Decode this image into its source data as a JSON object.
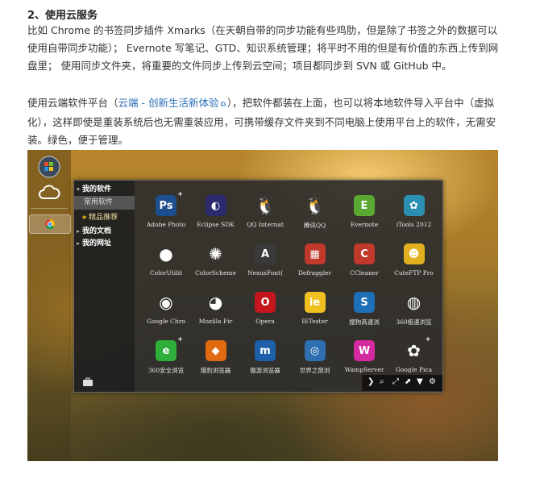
{
  "heading": "2、使用云服务",
  "para1": "比如 Chrome 的书签同步插件 Xmarks（在天朝自带的同步功能有些鸡肋，但是除了书签之外的数据可以使用自带同步功能）；  Evernote 写笔记、GTD、知识系统管理；将平时不用的但是有价值的东西上传到网盘里；  使用同步文件夹，将重要的文件同步上传到云空间；项目都同步到 SVN 或 GitHub 中。",
  "para2_before": "使用云端软件平台（",
  "para2_link": "云端 - 创新生活新体验",
  "para2_after": "），把软件都装在上面，也可以将本地软件导入平台中（虚拟化），这样即使是重装系统后也无需重装应用，可携带缓存文件夹到不同电脑上使用平台上的软件，无需安装。绿色，便于管理。",
  "nav": {
    "my_software": "我的软件",
    "common": "常用软件",
    "featured": "精品推荐",
    "my_docs": "我的文档",
    "my_sites": "我的网址"
  },
  "apps": [
    {
      "label": "Adobe Photo",
      "icon": "photoshop-icon",
      "glyph": "Ps",
      "color": "#1c4f8f",
      "plus": true
    },
    {
      "label": "Eclipse SDK",
      "icon": "eclipse-icon",
      "glyph": "◐",
      "color": "#2c2a6e",
      "plus": false
    },
    {
      "label": "QQ Internat",
      "icon": "qq-icon",
      "glyph": "🐧",
      "color": "transparent",
      "plus": false
    },
    {
      "label": "腾讯QQ",
      "icon": "qq-icon",
      "glyph": "🐧",
      "color": "transparent",
      "plus": false
    },
    {
      "label": "Evernote",
      "icon": "evernote-icon",
      "glyph": "E",
      "color": "#5aa832",
      "plus": false
    },
    {
      "label": "iTools 2012",
      "icon": "itools-icon",
      "glyph": "✿",
      "color": "#2a8fb0",
      "plus": false
    },
    {
      "label": "ColorUtilit",
      "icon": "color-wheel-icon",
      "glyph": "●",
      "color": "transparent",
      "plus": false
    },
    {
      "label": "ColorScheme",
      "icon": "color-scheme-icon",
      "glyph": "✺",
      "color": "transparent",
      "plus": false
    },
    {
      "label": "NexusFont(",
      "icon": "nexusfont-icon",
      "glyph": "A",
      "color": "#3a3a3a",
      "plus": false
    },
    {
      "label": "Defraggler",
      "icon": "defraggler-icon",
      "glyph": "▦",
      "color": "#c0392b",
      "plus": false
    },
    {
      "label": "CCleaner",
      "icon": "ccleaner-icon",
      "glyph": "C",
      "color": "#c0392b",
      "plus": false
    },
    {
      "label": "CuteFTP Pro",
      "icon": "cuteftp-icon",
      "glyph": "☻",
      "color": "#e0b020",
      "plus": false
    },
    {
      "label": "Google Chro",
      "icon": "chrome-icon",
      "glyph": "◉",
      "color": "transparent",
      "plus": false
    },
    {
      "label": "Mozilla Fir",
      "icon": "firefox-icon",
      "glyph": "◕",
      "color": "transparent",
      "plus": false
    },
    {
      "label": "Opera",
      "icon": "opera-icon",
      "glyph": "O",
      "color": "#c4161c",
      "plus": false
    },
    {
      "label": "IETester",
      "icon": "ietester-icon",
      "glyph": "ie",
      "color": "#f0c020",
      "plus": false
    },
    {
      "label": "搜狗高速浏",
      "icon": "sogou-icon",
      "glyph": "S",
      "color": "#1d6fb8",
      "plus": false
    },
    {
      "label": "360极速浏览",
      "icon": "360-extreme-icon",
      "glyph": "◍",
      "color": "transparent",
      "plus": false
    },
    {
      "label": "360安全浏览",
      "icon": "360-safe-icon",
      "glyph": "e",
      "color": "#2eae3a",
      "plus": true
    },
    {
      "label": "猎豹浏览器",
      "icon": "liebao-icon",
      "glyph": "◆",
      "color": "#e06a10",
      "plus": false
    },
    {
      "label": "傲游浏览器",
      "icon": "maxthon-icon",
      "glyph": "m",
      "color": "#1d5fa8",
      "plus": false
    },
    {
      "label": "世界之窗浏",
      "icon": "theworld-icon",
      "glyph": "◎",
      "color": "#2d6fb0",
      "plus": false
    },
    {
      "label": "WampServer",
      "icon": "wampserver-icon",
      "glyph": "W",
      "color": "#d62aa0",
      "plus": false
    },
    {
      "label": "Google Pica",
      "icon": "picasa-icon",
      "glyph": "✿",
      "color": "transparent",
      "plus": true
    }
  ]
}
